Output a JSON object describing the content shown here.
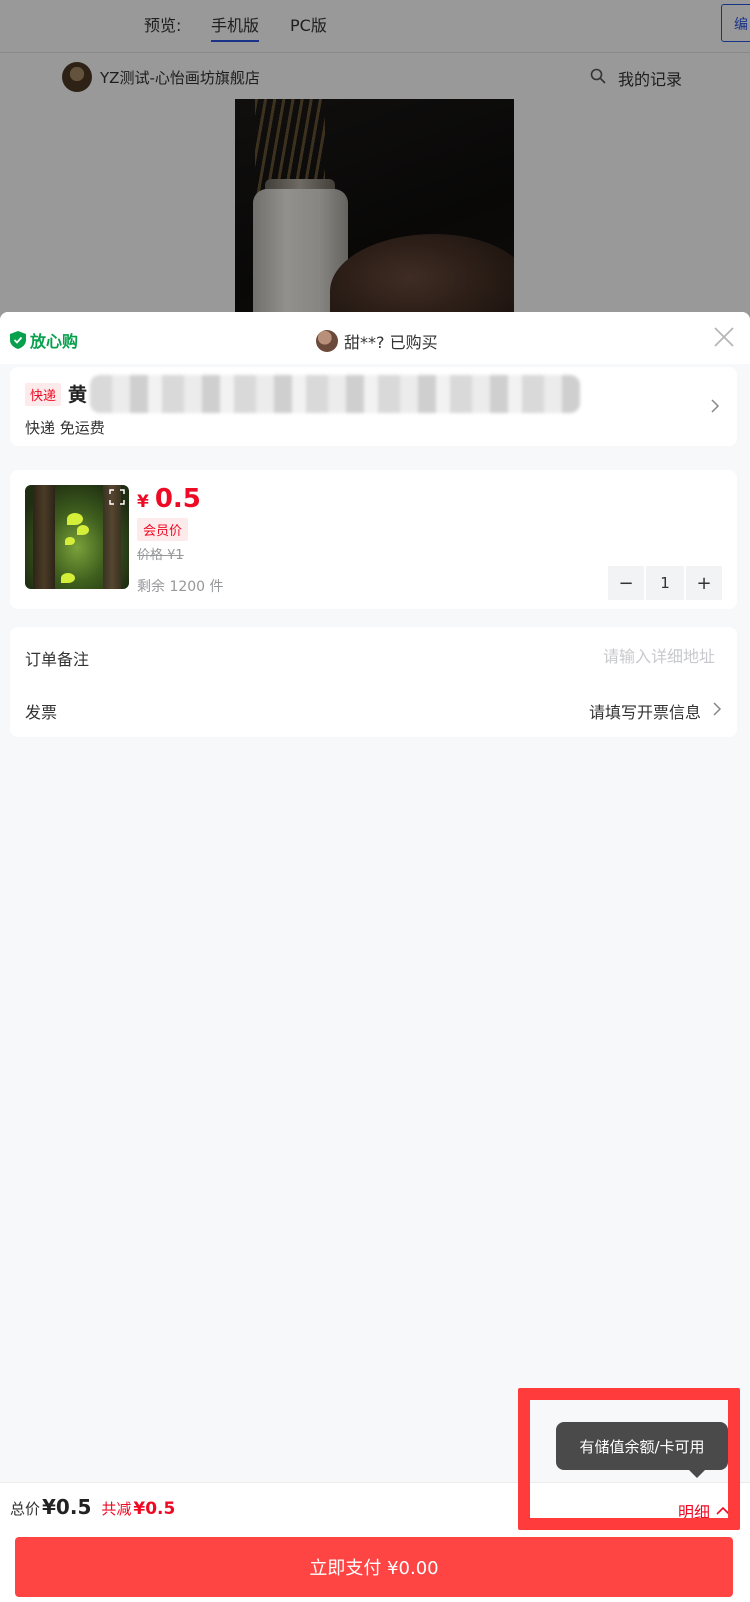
{
  "topbar": {
    "preview_label": "预览:",
    "tabs": [
      {
        "label": "手机版",
        "active": true
      },
      {
        "label": "PC版",
        "active": false
      }
    ],
    "edit_label": "编"
  },
  "shop": {
    "name": "YZ测试-心怡画坊旗舰店",
    "records_label": "我的记录"
  },
  "sheet": {
    "assurance_label": "放心购",
    "buyer_text": "甜**? 已购买",
    "address": {
      "tag": "快递",
      "name_visible": "黄",
      "tail_visible": "",
      "shipping": "快递 免运费"
    },
    "goods": {
      "currency": "¥",
      "price": "0.5",
      "member_tag": "会员价",
      "original_price": "价格 ¥1",
      "stock": "剩余  1200  件",
      "quantity": "1",
      "minus": "−",
      "plus": "+"
    },
    "form": {
      "remark_label": "订单备注",
      "remark_placeholder": "请输入详细地址",
      "invoice_label": "发票",
      "invoice_value": "请填写开票信息"
    }
  },
  "bottom": {
    "total_label": "总价",
    "total_value": "¥0.5",
    "discount_label": "共减",
    "discount_value": "¥0.5",
    "detail_label": "明细",
    "pay_label": "立即支付 ¥0.00",
    "tooltip": "有储值余额/卡可用"
  },
  "colors": {
    "accent_red": "#ee0a24",
    "pay_button": "#ff4444",
    "assurance_green": "#07a04c",
    "highlight_box": "#ff3b3b"
  },
  "icons": [
    "search-icon",
    "shield-icon",
    "close-icon",
    "chevron-right-icon",
    "zoom-icon",
    "chevron-up-icon"
  ]
}
